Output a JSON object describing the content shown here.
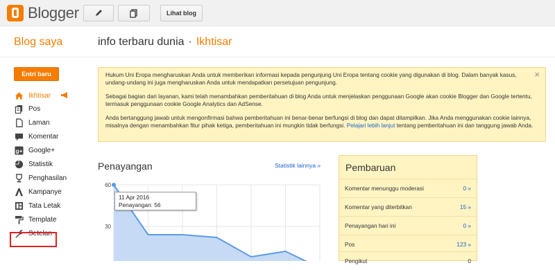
{
  "app": {
    "name": "Blogger",
    "brand_color": "#f57d00"
  },
  "toolbar": {
    "edit_icon": "pencil-icon",
    "posts_icon": "documents-icon",
    "view_blog_label": "Lihat blog"
  },
  "header": {
    "my_blogs": "Blog saya",
    "blog_name": "info terbaru dunia",
    "separator": "·",
    "section": "Ikhtisar"
  },
  "sidebar": {
    "new_post_label": "Entri baru",
    "items": [
      {
        "label": "Ikhtisar",
        "icon": "home-icon",
        "active": true
      },
      {
        "label": "Pos",
        "icon": "documents-icon"
      },
      {
        "label": "Laman",
        "icon": "page-icon"
      },
      {
        "label": "Komentar",
        "icon": "comment-icon"
      },
      {
        "label": "Google+",
        "icon": "google-plus-icon"
      },
      {
        "label": "Statistik",
        "icon": "pie-chart-icon"
      },
      {
        "label": "Penghasilan",
        "icon": "trophy-icon"
      },
      {
        "label": "Kampanye",
        "icon": "campaign-icon"
      },
      {
        "label": "Tata Letak",
        "icon": "layout-icon"
      },
      {
        "label": "Template",
        "icon": "paint-roller-icon"
      },
      {
        "label": "Setelan",
        "icon": "wrench-icon"
      }
    ]
  },
  "notice": {
    "para1": "Hukum Uni Eropa mengharuskan Anda untuk memberikan informasi kepada pengunjung Uni Eropa tentang cookie yang digunakan di blog. Dalam banyak kasus, undang-undang ini juga mengharuskan Anda untuk mendapatkan persetujuan pengunjung.",
    "para2": "Sebagai bagian dari layanan, kami telah menambahkan pemberitahuan di blog Anda untuk menjelaskan penggunaan Google akan cookie Blogger dan Google tertentu, termasuk penggunaan cookie Google Analytics dan AdSense.",
    "para3_start": "Anda bertanggung jawab untuk mengonfirmasi bahwa pemberitahuan ini benar-benar berfungsi di blog dan dapat ditampilkan. Jika Anda menggunakan cookie lainnya, misalnya dengan menambahkan fitur pihak ketiga, pemberitahuan ini mungkin tidak berfungsi.",
    "para3_link": "Pelajari lebih lanjut",
    "para3_end": "tentang pemberitahuan ini dan tanggung jawab Anda.",
    "close": "×"
  },
  "stats": {
    "title": "Penayangan",
    "more_link": "Statistik lainnya »",
    "tooltip_date": "11 Apr 2016",
    "tooltip_value": "Penayangan: 56"
  },
  "chart_data": {
    "type": "area",
    "yticks": [
      "60",
      "30"
    ],
    "ylim": [
      0,
      60
    ],
    "values": [
      60,
      24,
      24,
      22,
      8,
      12,
      0
    ],
    "fill_color": "#c6daf5",
    "line_color": "#5b9be6"
  },
  "updates": {
    "title": "Pembaruan",
    "rows": [
      {
        "label": "Komentar menunggu moderasi",
        "value": "0 »"
      },
      {
        "label": "Komentar yang diterbitkan",
        "value": "15 »"
      },
      {
        "label": "Penayangan hari ini",
        "value": "0 »"
      },
      {
        "label": "Pos",
        "value": "123 »"
      },
      {
        "label": "Pengikut",
        "value": "0"
      }
    ]
  }
}
